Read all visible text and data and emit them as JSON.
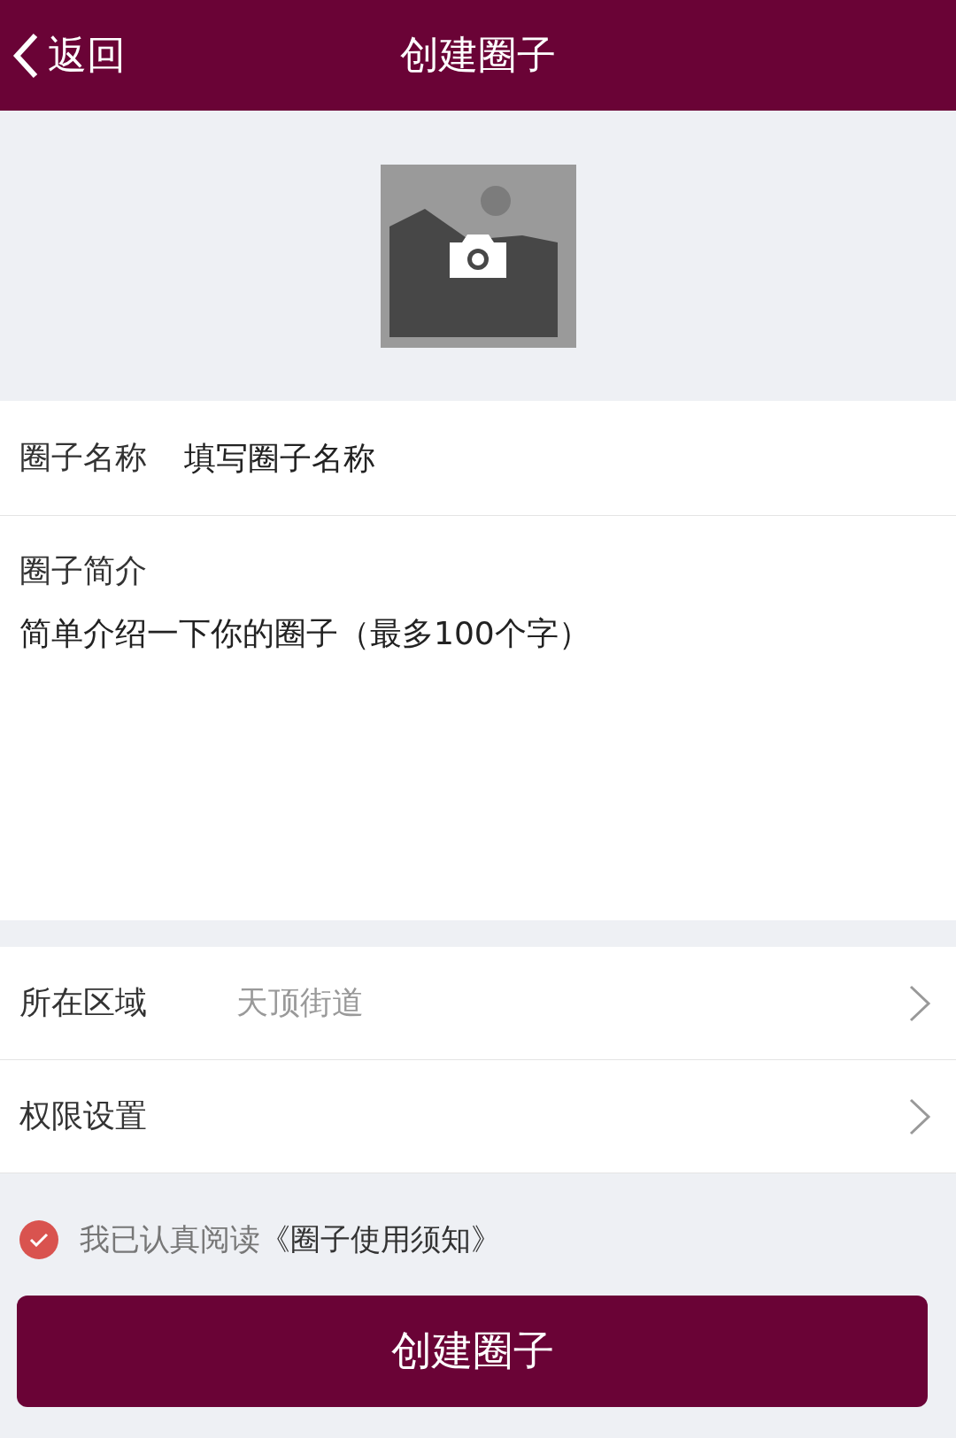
{
  "header": {
    "back_label": "返回",
    "title": "创建圈子"
  },
  "name_field": {
    "label": "圈子名称",
    "placeholder": "填写圈子名称"
  },
  "intro_field": {
    "label": "圈子简介",
    "placeholder": "简单介绍一下你的圈子（最多100个字）"
  },
  "settings": [
    {
      "label": "所在区域",
      "value": "天顶街道"
    },
    {
      "label": "权限设置"
    }
  ],
  "agreement": {
    "checked": true,
    "text": "我已认真阅读",
    "link": "《圈子使用须知》"
  },
  "submit_button": "创建圈子"
}
